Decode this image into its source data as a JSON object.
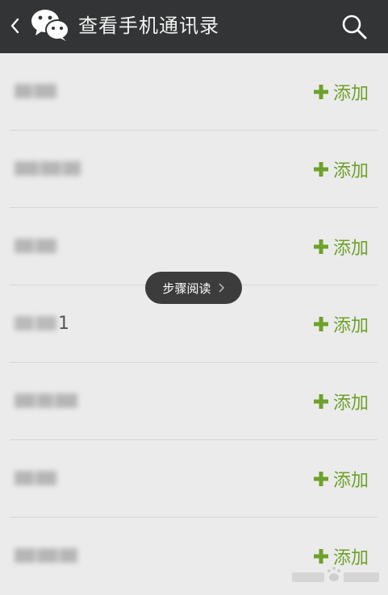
{
  "header": {
    "title": "查看手机通讯录",
    "back_icon": "chevron-left-icon",
    "logo_icon": "wechat-logo-icon",
    "search_icon": "search-icon"
  },
  "contacts": [
    {
      "name_suffix": "",
      "add_label": "添加"
    },
    {
      "name_suffix": "",
      "add_label": "添加"
    },
    {
      "name_suffix": "",
      "add_label": "添加"
    },
    {
      "name_suffix": "1",
      "add_label": "添加"
    },
    {
      "name_suffix": "",
      "add_label": "添加"
    },
    {
      "name_suffix": "",
      "add_label": "添加"
    },
    {
      "name_suffix": "",
      "add_label": "添加"
    }
  ],
  "toast": {
    "label": "步骤阅读"
  },
  "colors": {
    "topbar": "#333435",
    "background": "#ebebeb",
    "accent_green": "#6ea12a"
  }
}
